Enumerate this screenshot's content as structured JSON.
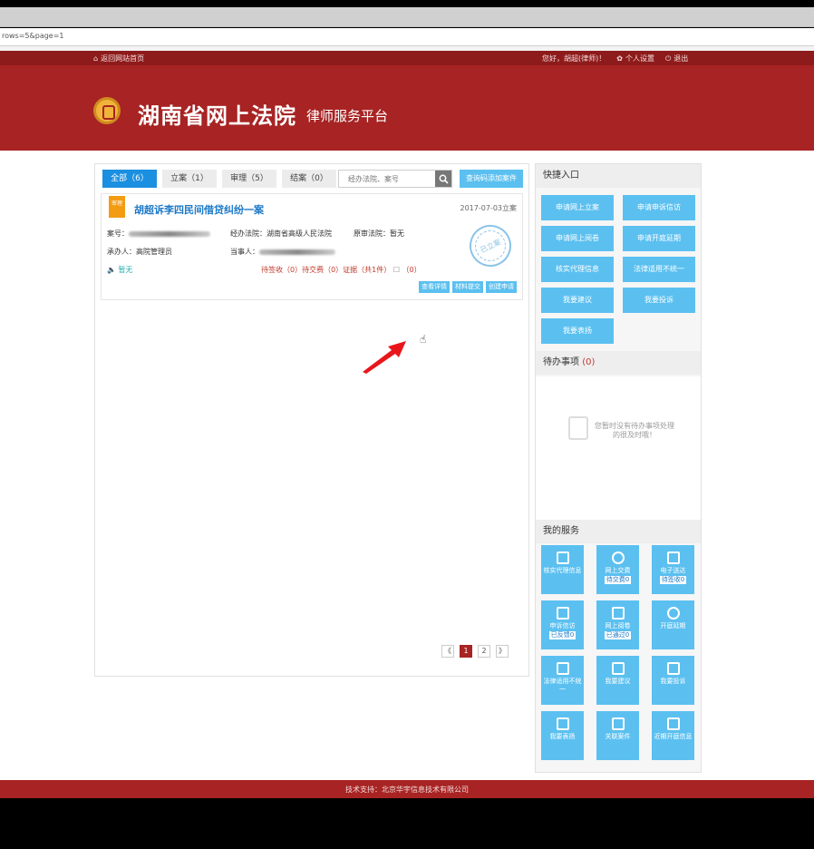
{
  "browser": {
    "url": "rows=5&page=1"
  },
  "topbar": {
    "home": "返回网站首页",
    "greeting": "您好，胡超(律师)！",
    "settings": "个人设置",
    "logout": "退出"
  },
  "header": {
    "title": "湖南省网上法院",
    "subtitle": "律师服务平台"
  },
  "tabs": [
    {
      "label": "全部（6）"
    },
    {
      "label": "立案（1）"
    },
    {
      "label": "审理（5）"
    },
    {
      "label": "结案（0）"
    }
  ],
  "search": {
    "placeholder": "经办法院、案号"
  },
  "add_case": "查询码添加案件",
  "case": {
    "ribbon": "审理",
    "title": "胡超诉李四民间借贷纠纷一案",
    "date": "2017-07-03立案",
    "case_no_label": "案号：",
    "court_label": "经办法院：湖南省高级人民法院",
    "original_court": "原审法院：暂无",
    "handler_label": "承办人：高院管理员",
    "party_label": "当事人：",
    "speaker": "暂无",
    "stats": "待签收（0）待交费（0）证据（共1件）",
    "comments": "（0）",
    "stamp": "已立案",
    "actions": [
      "查看详情",
      "材料提交",
      "创建申请"
    ]
  },
  "pager": {
    "prev": "《",
    "pages": [
      "1",
      "2"
    ],
    "next": "》"
  },
  "side": {
    "quick_title": "快捷入口",
    "quick": [
      "申请网上立案",
      "申请申诉信访",
      "申请网上阅卷",
      "申请开庭延期",
      "核实代理信息",
      "法律适用不统一",
      "我要建议",
      "我要投诉",
      "我要表扬"
    ],
    "todo_title": "待办事项",
    "todo_count": "(0)",
    "todo_msg": "您暂时没有待办事项处理的很及时哦！",
    "services_title": "我的服务",
    "services": [
      {
        "label": "核实代理信息",
        "badge": ""
      },
      {
        "label": "网上交费",
        "badge": "待交费0"
      },
      {
        "label": "电子送达",
        "badge": "待签收0"
      },
      {
        "label": "申诉信访",
        "badge": "已反馈0"
      },
      {
        "label": "网上阅卷",
        "badge": "已通过0"
      },
      {
        "label": "开庭延期",
        "badge": ""
      },
      {
        "label": "法律适用不统一",
        "badge": ""
      },
      {
        "label": "我要建议",
        "badge": ""
      },
      {
        "label": "我要投诉",
        "badge": ""
      },
      {
        "label": "我要表扬",
        "badge": ""
      },
      {
        "label": "关联案件",
        "badge": ""
      },
      {
        "label": "近期开庭信息",
        "badge": ""
      }
    ]
  },
  "footer": "技术支持：北京华宇信息技术有限公司",
  "colors": {
    "brand": "#a82323",
    "accent": "#5bc0f0",
    "tab_active": "#1b8fe0"
  }
}
